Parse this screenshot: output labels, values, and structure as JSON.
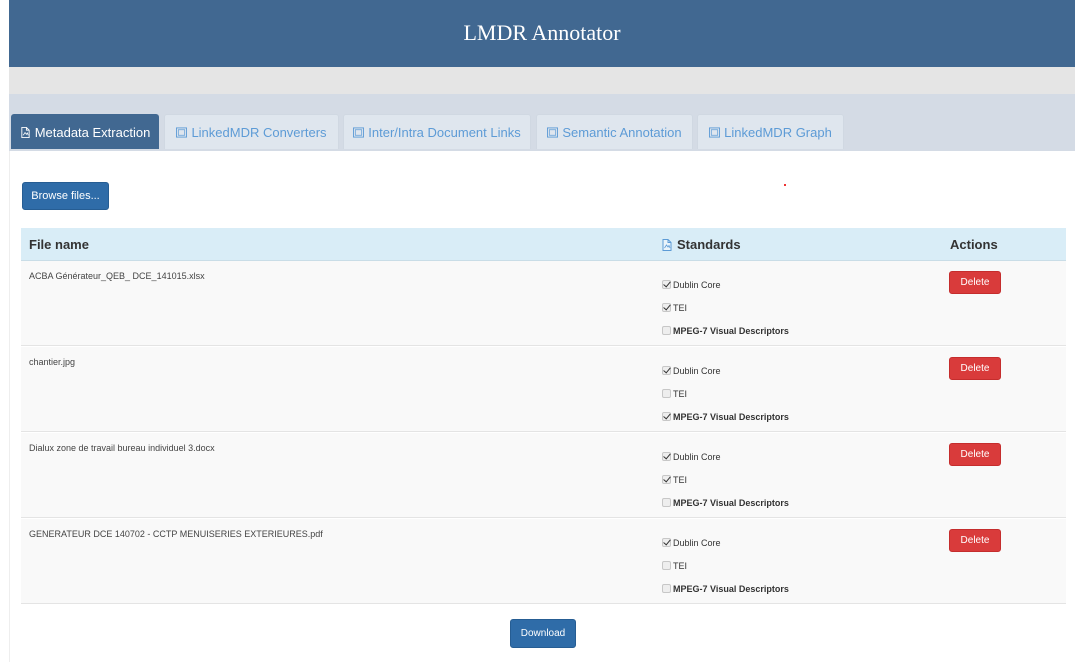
{
  "app": {
    "title": "LMDR Annotator"
  },
  "tabs": [
    {
      "label": "Metadata Extraction",
      "active": true,
      "icon": "document-icon"
    },
    {
      "label": "LinkedMDR Converters",
      "active": false,
      "icon": "picture-icon"
    },
    {
      "label": "Inter/Intra Document Links",
      "active": false,
      "icon": "picture-icon"
    },
    {
      "label": "Semantic Annotation",
      "active": false,
      "icon": "picture-icon"
    },
    {
      "label": "LinkedMDR Graph",
      "active": false,
      "icon": "picture-icon"
    }
  ],
  "toolbar": {
    "browse_label": "Browse files..."
  },
  "table": {
    "headers": {
      "file": "File name",
      "standards": "Standards",
      "actions": "Actions"
    },
    "rows": [
      {
        "file": "ACBA Générateur_QEB_ DCE_141015.xlsx",
        "standards": [
          {
            "label": "Dublin Core",
            "checked": true
          },
          {
            "label": "TEI",
            "checked": true
          },
          {
            "label": "MPEG-7 Visual Descriptors",
            "checked": false
          }
        ],
        "action": "Delete"
      },
      {
        "file": "chantier.jpg",
        "standards": [
          {
            "label": "Dublin Core",
            "checked": true
          },
          {
            "label": "TEI",
            "checked": false
          },
          {
            "label": "MPEG-7 Visual Descriptors",
            "checked": true
          }
        ],
        "action": "Delete"
      },
      {
        "file": "Dialux zone de travail bureau individuel 3.docx",
        "standards": [
          {
            "label": "Dublin Core",
            "checked": true
          },
          {
            "label": "TEI",
            "checked": true
          },
          {
            "label": "MPEG-7 Visual Descriptors",
            "checked": false
          }
        ],
        "action": "Delete"
      },
      {
        "file": "GENERATEUR DCE 140702 - CCTP MENUISERIES EXTERIEURES.pdf",
        "standards": [
          {
            "label": "Dublin Core",
            "checked": true
          },
          {
            "label": "TEI",
            "checked": false
          },
          {
            "label": "MPEG-7 Visual Descriptors",
            "checked": false
          }
        ],
        "action": "Delete"
      }
    ]
  },
  "footer": {
    "download_label": "Download"
  },
  "colors": {
    "header": "#416891",
    "primary_button": "#2f6ca8",
    "danger_button": "#d93b3b",
    "table_header": "#d9edf7",
    "inactive_tab_text": "#5d9bd6"
  }
}
